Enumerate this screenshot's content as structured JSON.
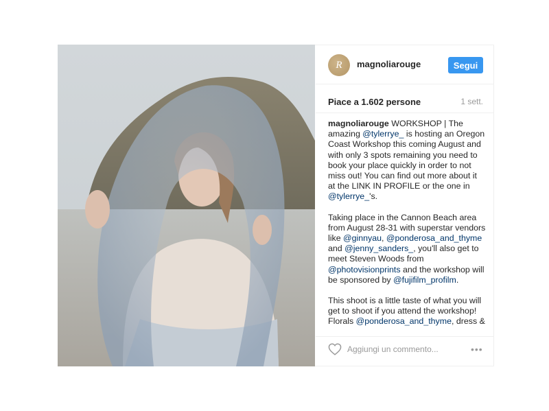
{
  "post": {
    "username": "magnoliarouge",
    "avatar_letter": "R",
    "follow_label": "Segui",
    "likes": "Piace a 1.602 persone",
    "time": "1 sett.",
    "caption": {
      "p1": {
        "author": "magnoliarouge",
        "t1": " WORKSHOP | The amazing ",
        "m1": "@tylerrye_",
        "t2": " is hosting an Oregon Coast Workshop this coming August and with only 3 spots remaining you need to book your place quickly in order to not miss out! You can find out more about it at the LINK IN PROFILE or the one in ",
        "m2": "@tylerrye_",
        "t3": "'s."
      },
      "p2": {
        "t1": "Taking place in the Cannon Beach area from August 28-31 with superstar vendors like ",
        "m1": "@ginnyau",
        "t2": ", ",
        "m2": "@ponderosa_and_thyme",
        "t3": " and ",
        "m3": "@jenny_sanders_",
        "t4": ", you'll also get to meet Steven Woods from ",
        "m4": "@photovisionprints",
        "t5": " and the workshop will be sponsored by ",
        "m5": "@fujifilm_profilm",
        "t6": "."
      },
      "p3": {
        "t1": "This shoot is a little taste of what you will get to shoot if you attend the workshop! Florals ",
        "m1": "@ponderosa_and_thyme",
        "t2": ", dress & veil"
      }
    },
    "comment_placeholder": "Aggiungi un commento...",
    "more_label": "•••"
  },
  "icons": {
    "like": "heart-icon",
    "options": "more-options-icon"
  },
  "colors": {
    "accent": "#3897f0",
    "mention": "#003569",
    "muted": "#999999",
    "avatar": "#c4a776"
  }
}
